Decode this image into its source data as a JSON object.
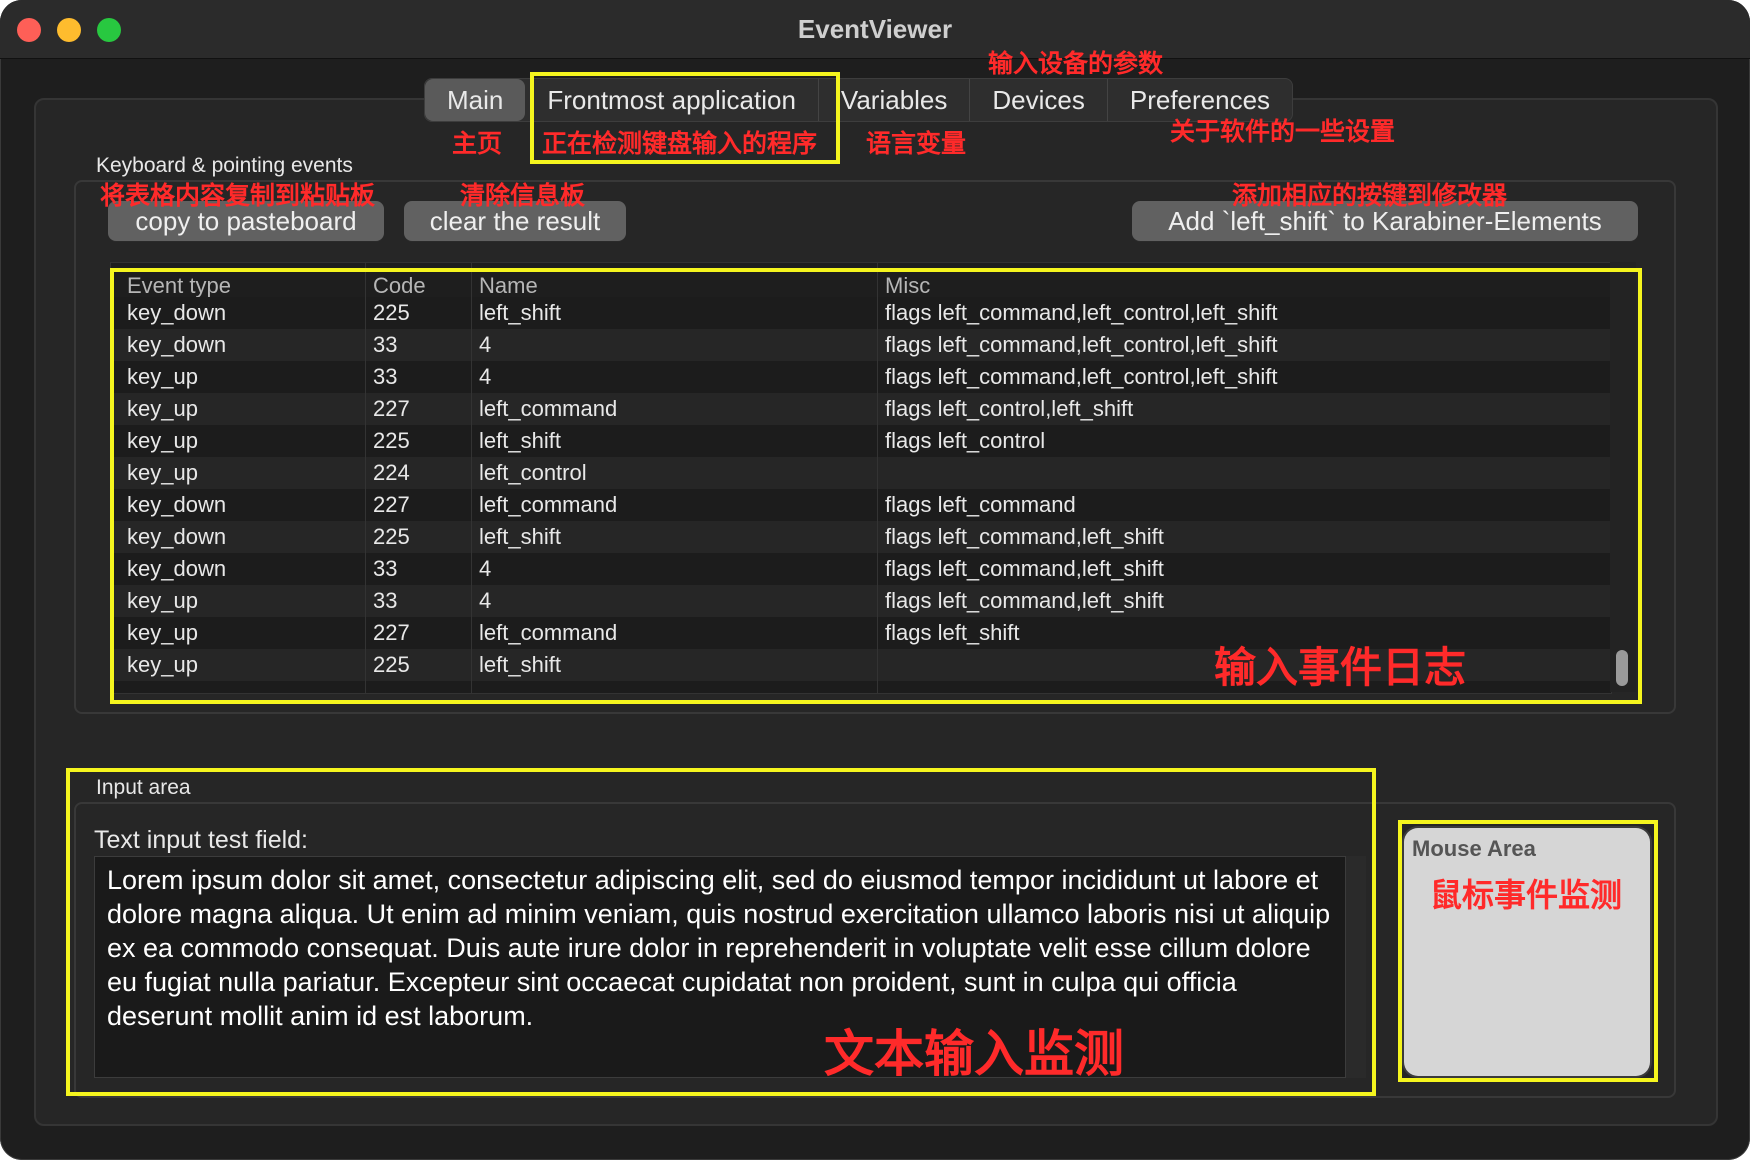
{
  "window": {
    "title": "EventViewer"
  },
  "tabs": [
    "Main",
    "Frontmost application",
    "Variables",
    "Devices",
    "Preferences"
  ],
  "keyboard_group": {
    "label": "Keyboard & pointing events",
    "copy_button": "copy to pasteboard",
    "clear_button": "clear the result",
    "add_button": "Add `left_shift` to Karabiner-Elements"
  },
  "table": {
    "columns": [
      "Event type",
      "Code",
      "Name",
      "Misc"
    ],
    "rows": [
      [
        "key_down",
        "225",
        "left_shift",
        "flags left_command,left_control,left_shift"
      ],
      [
        "key_down",
        "33",
        "4",
        "flags left_command,left_control,left_shift"
      ],
      [
        "key_up",
        "33",
        "4",
        "flags left_command,left_control,left_shift"
      ],
      [
        "key_up",
        "227",
        "left_command",
        "flags left_control,left_shift"
      ],
      [
        "key_up",
        "225",
        "left_shift",
        "flags left_control"
      ],
      [
        "key_up",
        "224",
        "left_control",
        ""
      ],
      [
        "key_down",
        "227",
        "left_command",
        "flags left_command"
      ],
      [
        "key_down",
        "225",
        "left_shift",
        "flags left_command,left_shift"
      ],
      [
        "key_down",
        "33",
        "4",
        "flags left_command,left_shift"
      ],
      [
        "key_up",
        "33",
        "4",
        "flags left_command,left_shift"
      ],
      [
        "key_up",
        "227",
        "left_command",
        "flags left_shift"
      ],
      [
        "key_up",
        "225",
        "left_shift",
        ""
      ]
    ]
  },
  "input_group": {
    "label": "Input area",
    "field_label": "Text input test field:",
    "field_value": "Lorem ipsum dolor sit amet, consectetur adipiscing elit, sed do eiusmod tempor incididunt ut labore et dolore magna aliqua. Ut enim ad minim veniam, quis nostrud exercitation ullamco laboris nisi ut aliquip ex ea commodo consequat. Duis aute irure dolor in reprehenderit in voluptate velit esse cillum dolore eu fugiat nulla pariatur. Excepteur sint occaecat cupidatat non proident, sunt in culpa qui officia deserunt mollit anim id est laborum."
  },
  "mouse_area": {
    "label": "Mouse Area"
  },
  "annotations": {
    "main": "主页",
    "frontmost": "正在检测键盘输入的程序",
    "variables": "语言变量",
    "devices": "输入设备的参数",
    "preferences": "关于软件的一些设置",
    "copy": "将表格内容复制到粘贴板",
    "clear": "清除信息板",
    "add": "添加相应的按键到修改器",
    "log": "输入事件日志",
    "text": "文本输入监测",
    "mouse": "鼠标事件监测"
  },
  "colors": {
    "highlight": "#f5f51e",
    "annotation": "#ff2a2a",
    "window_bg": "#1e1e1e"
  }
}
